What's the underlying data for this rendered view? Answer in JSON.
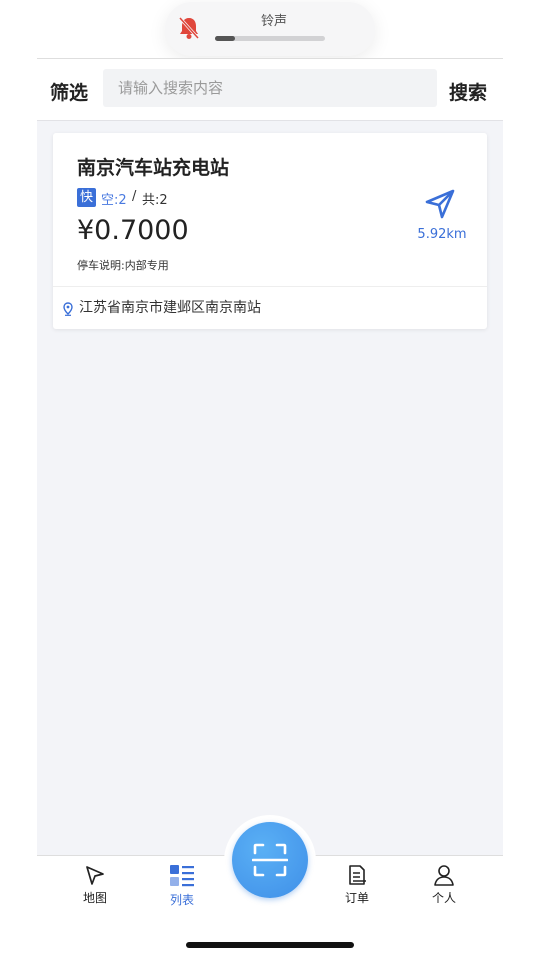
{
  "ringer": {
    "title": "铃声",
    "volume_fraction": 0.18,
    "icon": "bell-muted-icon",
    "icon_color": "#e0473c"
  },
  "search": {
    "filter_label": "筛选",
    "placeholder": "请输入搜索内容",
    "value": "",
    "search_label": "搜索"
  },
  "stations": [
    {
      "name": "南京汽车站充电站",
      "charge_type": "快",
      "available": "空:2",
      "separator": "/",
      "total": "共:2",
      "price": "¥0.7000",
      "parking_note": "停车说明:内部专用",
      "distance": "5.92km",
      "address": "江苏省南京市建邺区南京南站"
    }
  ],
  "tabbar": {
    "items": [
      {
        "label": "地图",
        "icon": "map-arrow-icon"
      },
      {
        "label": "列表",
        "icon": "list-icon",
        "active": true
      },
      {
        "label": "",
        "icon": "scan-icon"
      },
      {
        "label": "订单",
        "icon": "order-icon"
      },
      {
        "label": "个人",
        "icon": "person-icon"
      }
    ]
  },
  "colors": {
    "accent": "#3a6fd8",
    "background": "#f3f4f8",
    "scan_button": "#4a9cf0"
  }
}
